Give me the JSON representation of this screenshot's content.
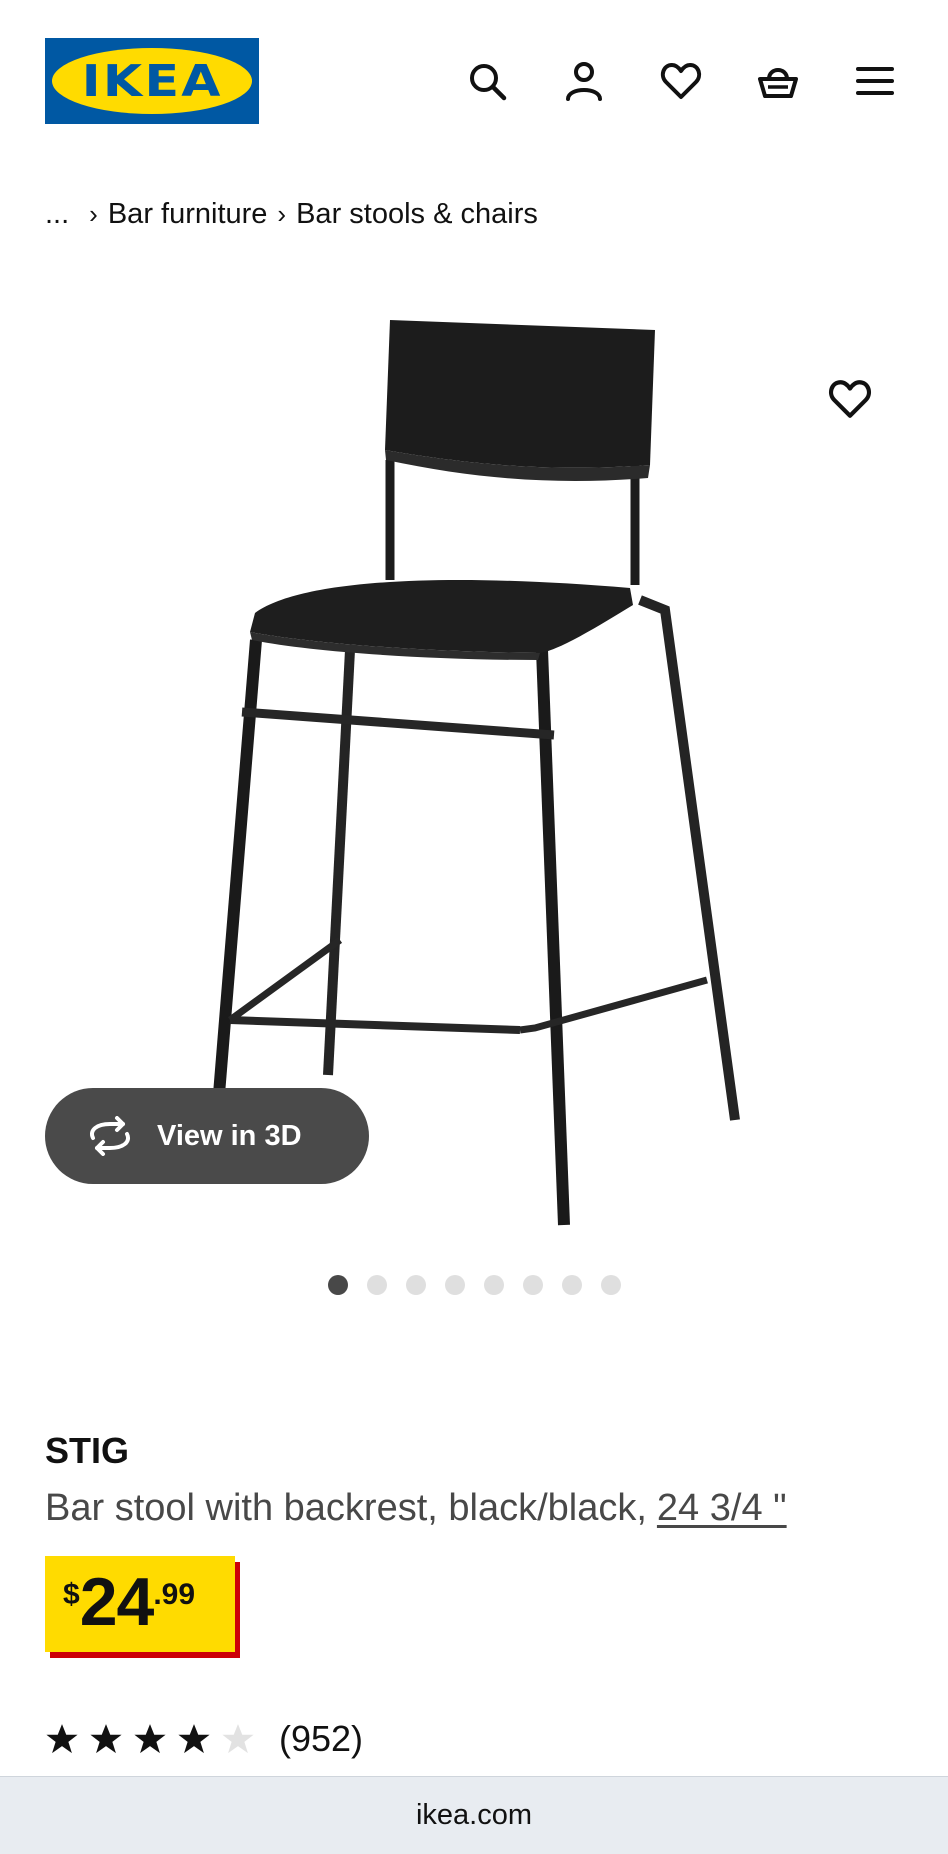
{
  "header": {
    "logo_text": "IKEA",
    "icons": [
      "search-icon",
      "account-icon",
      "heart-icon",
      "basket-icon",
      "menu-icon"
    ],
    "brand_colors": {
      "blue": "#0058a3",
      "yellow": "#ffdb00"
    }
  },
  "breadcrumb": {
    "ellipsis": "...",
    "items": [
      "Bar furniture",
      "Bar stools & chairs"
    ]
  },
  "gallery": {
    "view_3d_label": "View in 3D",
    "slide_count": 8,
    "active_slide": 1
  },
  "product": {
    "name": "STIG",
    "description": "Bar stool with backrest, black/black,",
    "size": "24 3/4 \"",
    "price": {
      "currency": "$",
      "integer": "24",
      "decimal": ".99",
      "colors": {
        "tag": "#ffdb00",
        "shadow": "#cc0008"
      }
    },
    "rating": {
      "stars": 4,
      "max": 5,
      "count": "(952)"
    }
  },
  "browser": {
    "url": "ikea.com"
  }
}
